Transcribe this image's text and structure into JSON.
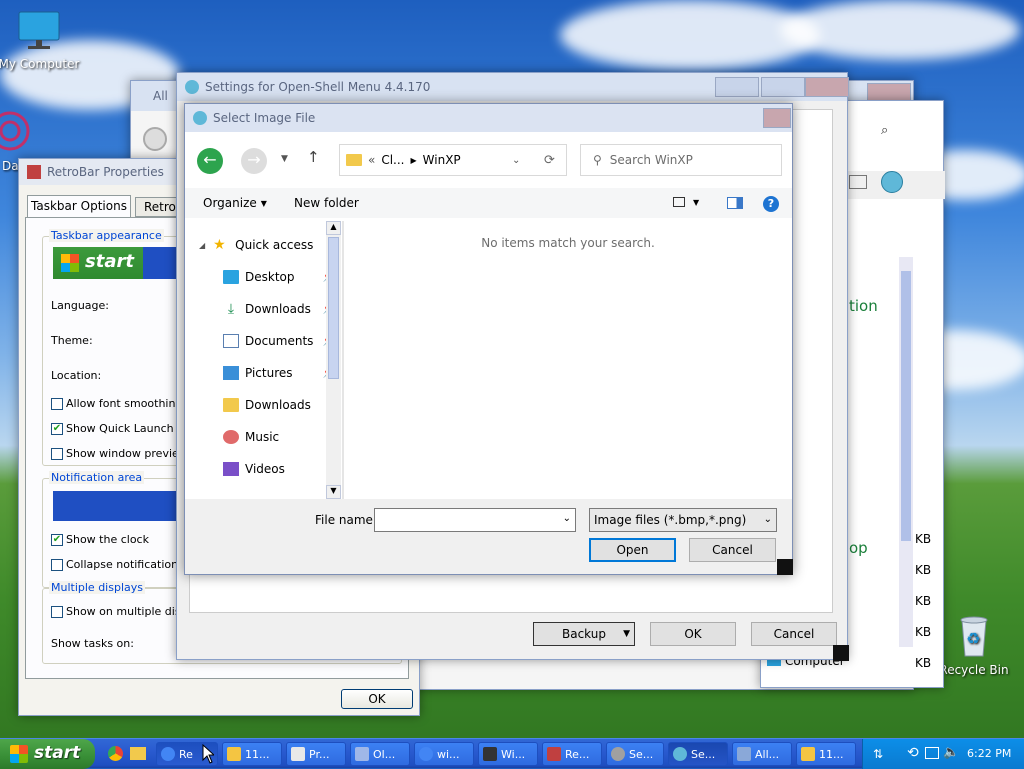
{
  "desktop": {
    "icons": [
      {
        "label": "My Computer",
        "icon": "monitor-icon"
      },
      {
        "label": "Da",
        "icon": "shortcut-icon"
      },
      {
        "label": "Recycle Bin",
        "icon": "recycle-bin-icon"
      }
    ]
  },
  "background_windows": {
    "all_title": "All",
    "right_win": {
      "text_fragment_1": "tion",
      "text_fragment_2": "op",
      "computer": "Computer",
      "sizes": [
        "KB",
        "KB",
        "KB",
        "KB",
        "KB"
      ]
    }
  },
  "retrobar": {
    "title": "RetroBar Properties",
    "tabs": [
      "Taskbar Options",
      "RetroB"
    ],
    "group_taskbar": "Taskbar appearance",
    "start_label": "start",
    "language_label": "Language:",
    "theme_label": "Theme:",
    "location_label": "Location:",
    "allow_font_smoothing": "Allow font smoothing",
    "show_quick_launch": "Show Quick Launch",
    "show_window_previews": "Show window previews",
    "group_notification": "Notification area",
    "show_clock": "Show the clock",
    "collapse_notification": "Collapse notification ar",
    "group_multiple": "Multiple displays",
    "show_on_multiple": "Show on multiple displa",
    "show_tasks_on": "Show tasks on:",
    "ok": "OK"
  },
  "settings": {
    "title": "Settings for Open-Shell Menu 4.4.170",
    "backup": "Backup",
    "ok": "OK",
    "cancel": "Cancel"
  },
  "dialog": {
    "title": "Select Image File",
    "breadcrumb": [
      "Cl...",
      "WinXP"
    ],
    "breadcrumb_prefix": "«",
    "search_placeholder": "Search WinXP",
    "organize": "Organize",
    "new_folder": "New folder",
    "empty_message": "No items match your search.",
    "sidebar": [
      {
        "label": "Quick access",
        "icon": "star-icon",
        "pinned": false
      },
      {
        "label": "Desktop",
        "icon": "desktop-folder-icon",
        "pinned": true
      },
      {
        "label": "Downloads",
        "icon": "download-icon",
        "pinned": true
      },
      {
        "label": "Documents",
        "icon": "documents-icon",
        "pinned": true
      },
      {
        "label": "Pictures",
        "icon": "pictures-icon",
        "pinned": true
      },
      {
        "label": "Downloads",
        "icon": "folder-icon",
        "pinned": false
      },
      {
        "label": "Music",
        "icon": "music-icon",
        "pinned": false
      },
      {
        "label": "Videos",
        "icon": "videos-icon",
        "pinned": false
      }
    ],
    "file_name_label": "File name:",
    "file_name_value": "",
    "file_type": "Image files (*.bmp,*.png)",
    "open": "Open",
    "cancel": "Cancel"
  },
  "taskbar": {
    "start": "start",
    "tasks": [
      {
        "label": "Re",
        "color": "#4285f4"
      },
      {
        "label": "11...",
        "color": "#f4c542"
      },
      {
        "label": "Pr...",
        "color": "#e8e8e8"
      },
      {
        "label": "Ol...",
        "color": "#9fb7e8"
      },
      {
        "label": "wi...",
        "color": "#4285f4"
      },
      {
        "label": "Wi...",
        "color": "#333333"
      },
      {
        "label": "Re...",
        "color": "#c04040"
      },
      {
        "label": "Se...",
        "color": "#a0a0a0"
      },
      {
        "label": "Se...",
        "color": "#5fb8d8"
      },
      {
        "label": "All...",
        "color": "#8aa8d8"
      },
      {
        "label": "11...",
        "color": "#f4c542"
      }
    ],
    "clock": "6:22 PM"
  }
}
